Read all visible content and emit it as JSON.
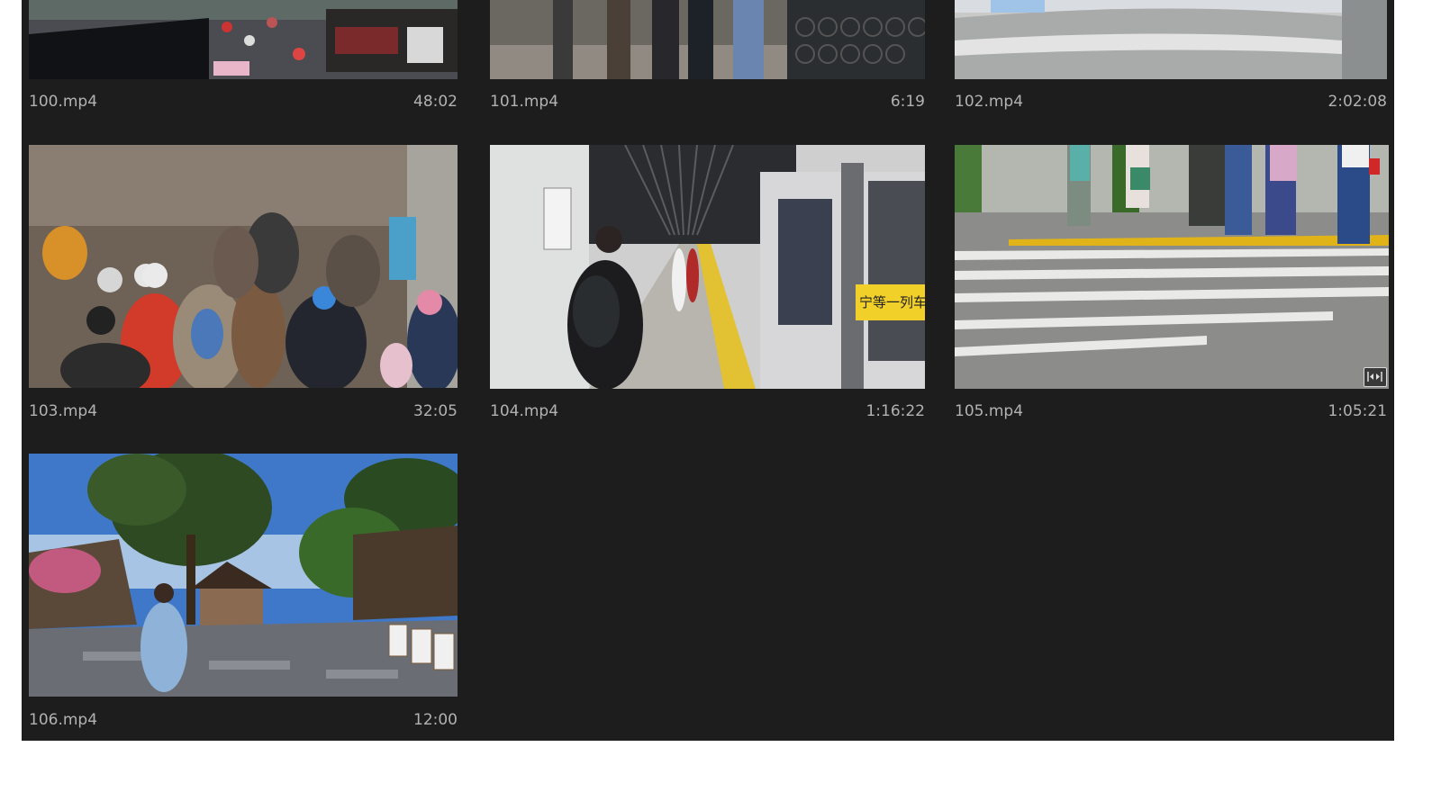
{
  "clips": [
    {
      "filename": "100.mp4",
      "duration": "48:02",
      "scene": "street-market"
    },
    {
      "filename": "101.mp4",
      "duration": "6:19",
      "scene": "walkway-legs"
    },
    {
      "filename": "102.mp4",
      "duration": "2:02:08",
      "scene": "metal-turnstile"
    },
    {
      "filename": "103.mp4",
      "duration": "32:05",
      "scene": "crowd"
    },
    {
      "filename": "104.mp4",
      "duration": "1:16:22",
      "scene": "subway-platform",
      "sign_text": "宁等一列车 不"
    },
    {
      "filename": "105.mp4",
      "duration": "1:05:21",
      "scene": "crosswalk",
      "badge_icon": "fit-to-frame-icon"
    },
    {
      "filename": "106.mp4",
      "duration": "12:00",
      "scene": "old-town-tree"
    }
  ],
  "colors": {
    "panel_bg": "#1d1d1d",
    "meta_text": "#b2b2b2",
    "page_bg": "#ffffff"
  }
}
